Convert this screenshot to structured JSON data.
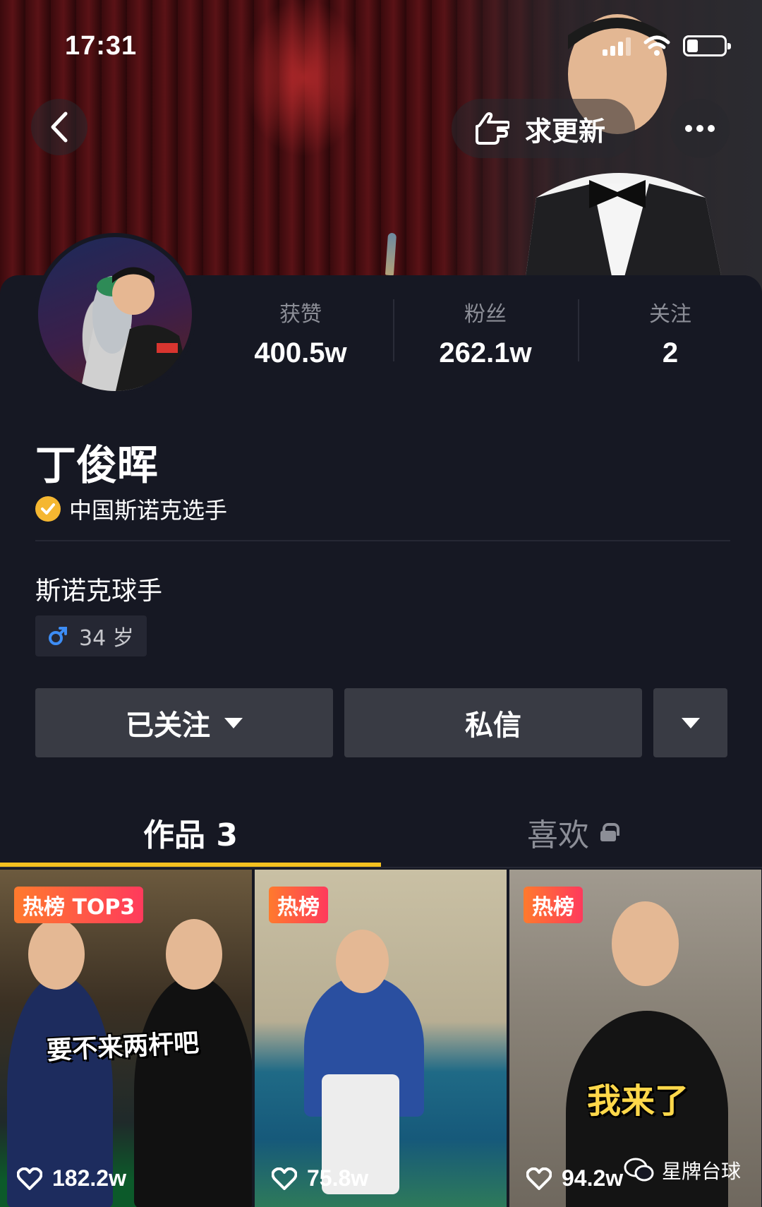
{
  "status_bar": {
    "time": "17:31",
    "battery_level": 0.3
  },
  "header": {
    "update_label": "求更新"
  },
  "profile": {
    "name": "丁俊晖",
    "verified_label": "中国斯诺克选手",
    "bio": "斯诺克球手",
    "age_tag": "34 岁"
  },
  "stats": [
    {
      "label": "获赞",
      "value": "400.5w"
    },
    {
      "label": "粉丝",
      "value": "262.1w"
    },
    {
      "label": "关注",
      "value": "2"
    }
  ],
  "actions": {
    "followed_label": "已关注",
    "message_label": "私信"
  },
  "tabs": [
    {
      "label": "作品 3"
    },
    {
      "label": "喜欢"
    }
  ],
  "videos": [
    {
      "tag": "热榜 TOP3",
      "caption": "要不来两杆吧",
      "likes": "182.2w"
    },
    {
      "tag": "热榜",
      "caption": "",
      "likes": "75.8w"
    },
    {
      "tag": "热榜",
      "caption": "我来了",
      "likes": "94.2w"
    }
  ],
  "watermark": "星牌台球",
  "colors": {
    "tab_indicator": "#f4c020",
    "verify_badge": "#f5b731",
    "hot_tag_start": "#ff7a2d",
    "hot_tag_end": "#ff3a5c"
  }
}
